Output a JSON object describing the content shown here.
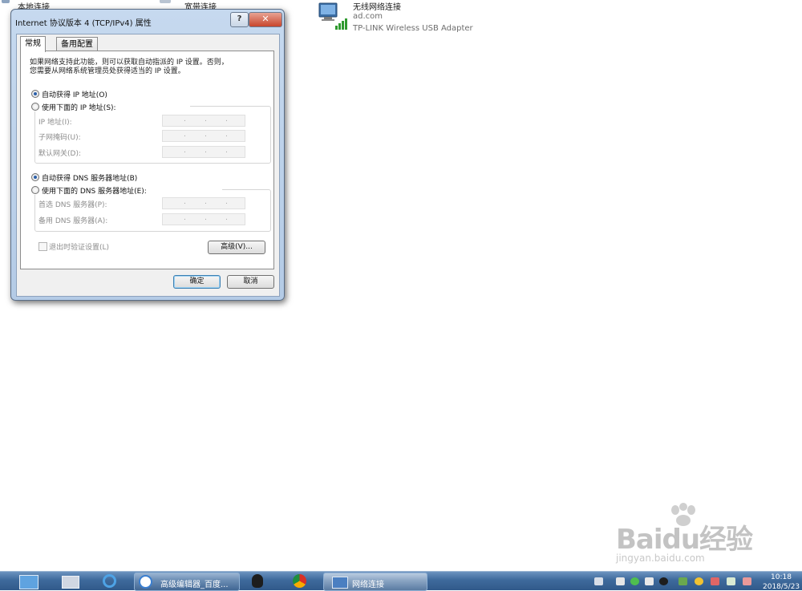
{
  "background": {
    "items": [
      {
        "label": "本地连接"
      },
      {
        "label": "宽带连接"
      },
      {
        "label": "无线网络连接",
        "sub1": "ad.com",
        "sub2": "TP-LINK Wireless USB Adapter"
      }
    ]
  },
  "dialog": {
    "title": "Internet 协议版本 4 (TCP/IPv4) 属性",
    "help_label": "?",
    "close_label": "✕",
    "tabs": [
      {
        "label": "常规"
      },
      {
        "label": "备用配置"
      }
    ],
    "description": [
      "如果网络支持此功能，则可以获取自动指派的 IP 设置。否则，",
      "您需要从网络系统管理员处获得适当的 IP 设置。"
    ],
    "ip_auto_label": "自动获得 IP 地址(O)",
    "ip_manual_label": "使用下面的 IP 地址(S):",
    "ip_fields": [
      {
        "label": "IP 地址(I):"
      },
      {
        "label": "子网掩码(U):"
      },
      {
        "label": "默认网关(D):"
      }
    ],
    "dns_auto_label": "自动获得 DNS 服务器地址(B)",
    "dns_manual_label": "使用下面的 DNS 服务器地址(E):",
    "dns_fields": [
      {
        "label": "首选 DNS 服务器(P):"
      },
      {
        "label": "备用 DNS 服务器(A):"
      }
    ],
    "dot": ".",
    "validate_label": "退出时验证设置(L)",
    "advanced_label": "高级(V)...",
    "ok_label": "确定",
    "cancel_label": "取消",
    "selected": {
      "ip": "auto",
      "dns": "auto",
      "validate": false
    }
  },
  "taskbar": {
    "items": [
      {
        "label": "高级编辑器_百度..."
      },
      {
        "label": "网络连接"
      }
    ],
    "clock": {
      "time": "10:18",
      "date": "2018/5/23"
    }
  },
  "watermark": {
    "logo": "Baidu经验",
    "url": "jingyan.baidu.com"
  }
}
